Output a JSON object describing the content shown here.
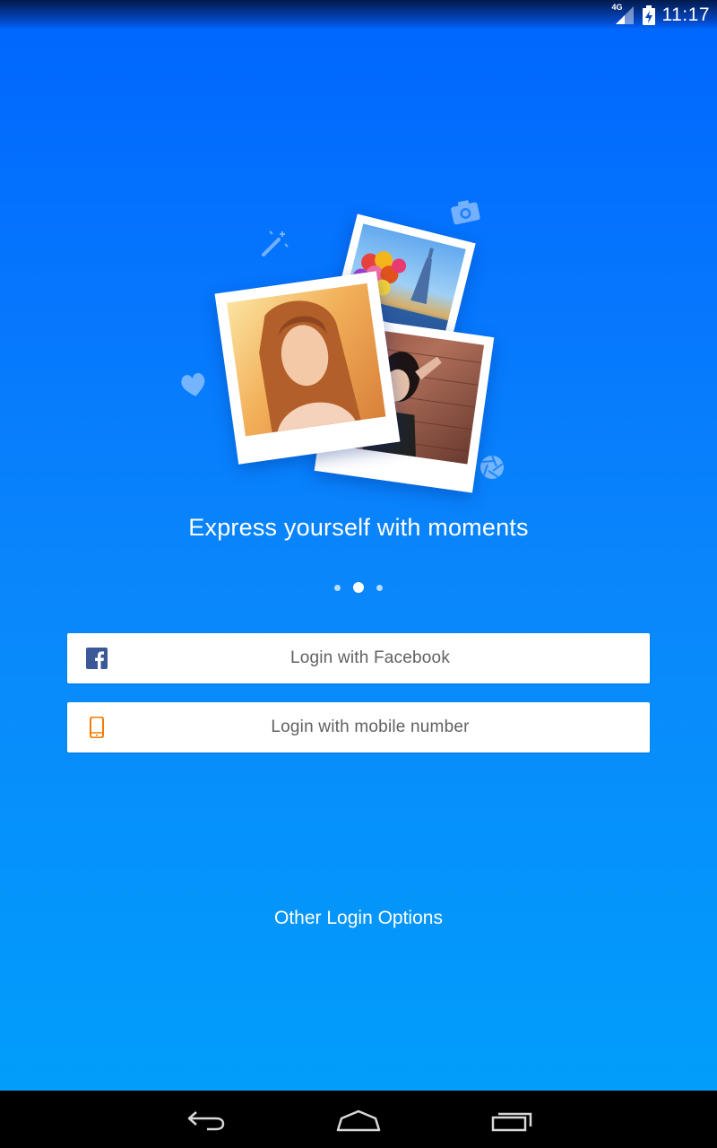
{
  "status_bar": {
    "network_type": "4G",
    "time": "11:17"
  },
  "onboarding": {
    "tagline": "Express yourself with moments",
    "pager": {
      "total_pages": 3,
      "current_page": 2
    }
  },
  "login": {
    "facebook_label": "Login with Facebook",
    "mobile_label": "Login with mobile number",
    "other_options_label": "Other Login Options"
  },
  "icons": {
    "facebook": "facebook-icon",
    "mobile": "mobile-phone-icon",
    "magic_wand": "magic-wand-icon",
    "camera": "camera-icon",
    "heart": "heart-icon",
    "aperture": "aperture-icon"
  },
  "colors": {
    "background_top": "#0066ff",
    "background_bottom": "#00a0fb",
    "facebook_brand": "#3b5998",
    "mobile_icon": "#f57c00",
    "button_text": "#616161"
  }
}
